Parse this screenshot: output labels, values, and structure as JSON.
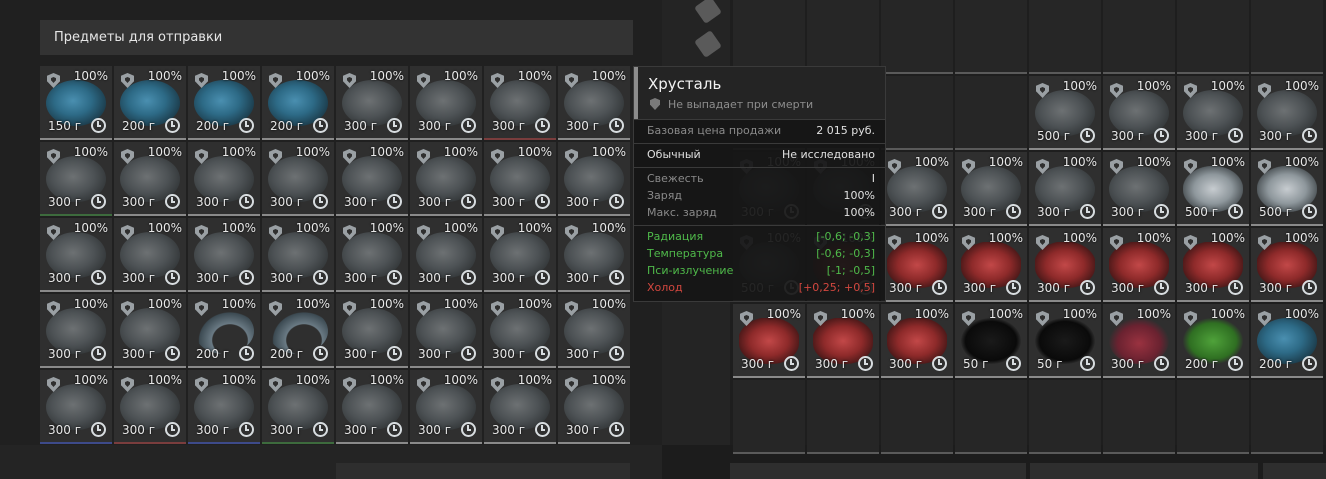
{
  "header": {
    "title": "Предметы для отправки"
  },
  "left_items": [
    {
      "pct": "100%",
      "weight": "150 г",
      "art": "blue",
      "border": "gray"
    },
    {
      "pct": "100%",
      "weight": "200 г",
      "art": "blue",
      "border": "gray"
    },
    {
      "pct": "100%",
      "weight": "200 г",
      "art": "blue",
      "border": "gray"
    },
    {
      "pct": "100%",
      "weight": "200 г",
      "art": "blue",
      "border": "gray"
    },
    {
      "pct": "100%",
      "weight": "300 г",
      "art": "stone",
      "border": "gray"
    },
    {
      "pct": "100%",
      "weight": "300 г",
      "art": "stone",
      "border": "gray"
    },
    {
      "pct": "100%",
      "weight": "300 г",
      "art": "stone",
      "border": "red"
    },
    {
      "pct": "100%",
      "weight": "300 г",
      "art": "stone",
      "border": "gray"
    },
    {
      "pct": "100%",
      "weight": "300 г",
      "art": "stone",
      "border": "green"
    },
    {
      "pct": "100%",
      "weight": "300 г",
      "art": "stone",
      "border": "gray"
    },
    {
      "pct": "100%",
      "weight": "300 г",
      "art": "stone",
      "border": "gray"
    },
    {
      "pct": "100%",
      "weight": "300 г",
      "art": "stone",
      "border": "gray"
    },
    {
      "pct": "100%",
      "weight": "300 г",
      "art": "stone",
      "border": "gray"
    },
    {
      "pct": "100%",
      "weight": "300 г",
      "art": "stone",
      "border": "gray"
    },
    {
      "pct": "100%",
      "weight": "300 г",
      "art": "stone",
      "border": "gray"
    },
    {
      "pct": "100%",
      "weight": "300 г",
      "art": "stone",
      "border": "gray"
    },
    {
      "pct": "100%",
      "weight": "300 г",
      "art": "stone",
      "border": "gray"
    },
    {
      "pct": "100%",
      "weight": "300 г",
      "art": "stone",
      "border": "gray"
    },
    {
      "pct": "100%",
      "weight": "300 г",
      "art": "stone",
      "border": "gray"
    },
    {
      "pct": "100%",
      "weight": "300 г",
      "art": "stone",
      "border": "gray"
    },
    {
      "pct": "100%",
      "weight": "300 г",
      "art": "stone",
      "border": "gray"
    },
    {
      "pct": "100%",
      "weight": "300 г",
      "art": "stone",
      "border": "gray"
    },
    {
      "pct": "100%",
      "weight": "300 г",
      "art": "stone",
      "border": "gray"
    },
    {
      "pct": "100%",
      "weight": "300 г",
      "art": "stone",
      "border": "gray"
    },
    {
      "pct": "100%",
      "weight": "300 г",
      "art": "stone",
      "border": "gray"
    },
    {
      "pct": "100%",
      "weight": "300 г",
      "art": "stone",
      "border": "gray"
    },
    {
      "pct": "100%",
      "weight": "200 г",
      "art": "crescent",
      "border": "gray"
    },
    {
      "pct": "100%",
      "weight": "200 г",
      "art": "crescent",
      "border": "gray"
    },
    {
      "pct": "100%",
      "weight": "300 г",
      "art": "stone",
      "border": "gray"
    },
    {
      "pct": "100%",
      "weight": "300 г",
      "art": "stone",
      "border": "gray"
    },
    {
      "pct": "100%",
      "weight": "300 г",
      "art": "stone",
      "border": "gray"
    },
    {
      "pct": "100%",
      "weight": "300 г",
      "art": "stone",
      "border": "gray"
    },
    {
      "pct": "100%",
      "weight": "300 г",
      "art": "stone",
      "border": "blue"
    },
    {
      "pct": "100%",
      "weight": "300 г",
      "art": "stone",
      "border": "red"
    },
    {
      "pct": "100%",
      "weight": "300 г",
      "art": "stone",
      "border": "blue"
    },
    {
      "pct": "100%",
      "weight": "300 г",
      "art": "stone",
      "border": "green"
    },
    {
      "pct": "100%",
      "weight": "300 г",
      "art": "stone",
      "border": "gray"
    },
    {
      "pct": "100%",
      "weight": "300 г",
      "art": "stone",
      "border": "gray"
    },
    {
      "pct": "100%",
      "weight": "300 г",
      "art": "stone",
      "border": "gray"
    },
    {
      "pct": "100%",
      "weight": "300 г",
      "art": "stone",
      "border": "gray"
    }
  ],
  "right_items": [
    null,
    null,
    null,
    null,
    null,
    null,
    null,
    null,
    null,
    null,
    null,
    null,
    {
      "pct": "100%",
      "weight": "500 г",
      "art": "stone",
      "border": "gray"
    },
    {
      "pct": "100%",
      "weight": "300 г",
      "art": "stone",
      "border": "gray"
    },
    {
      "pct": "100%",
      "weight": "300 г",
      "art": "stone",
      "border": "gray"
    },
    {
      "pct": "100%",
      "weight": "300 г",
      "art": "stone",
      "border": "gray"
    },
    {
      "pct": "100%",
      "weight": "300 г",
      "art": "stone",
      "border": "gray"
    },
    {
      "pct": "100%",
      "weight": "",
      "art": "stone",
      "border": "gray"
    },
    {
      "pct": "100%",
      "weight": "300 г",
      "art": "stone",
      "border": "gray"
    },
    {
      "pct": "100%",
      "weight": "300 г",
      "art": "stone",
      "border": "gray"
    },
    {
      "pct": "100%",
      "weight": "300 г",
      "art": "stone",
      "border": "gray"
    },
    {
      "pct": "100%",
      "weight": "300 г",
      "art": "stone",
      "border": "gray"
    },
    {
      "pct": "100%",
      "weight": "500 г",
      "art": "white",
      "border": "gray"
    },
    {
      "pct": "100%",
      "weight": "500 г",
      "art": "white",
      "border": "gray"
    },
    {
      "pct": "100%",
      "weight": "500 г",
      "art": "stone",
      "border": "gray"
    },
    {
      "pct": "100%",
      "weight": "",
      "art": "red",
      "border": "gray"
    },
    {
      "pct": "100%",
      "weight": "300 г",
      "art": "red",
      "border": "gray"
    },
    {
      "pct": "100%",
      "weight": "300 г",
      "art": "red",
      "border": "gray"
    },
    {
      "pct": "100%",
      "weight": "300 г",
      "art": "red",
      "border": "gray"
    },
    {
      "pct": "100%",
      "weight": "300 г",
      "art": "red",
      "border": "gray"
    },
    {
      "pct": "100%",
      "weight": "300 г",
      "art": "red",
      "border": "gray"
    },
    {
      "pct": "100%",
      "weight": "300 г",
      "art": "red",
      "border": "gray"
    },
    {
      "pct": "100%",
      "weight": "300 г",
      "art": "red",
      "border": "gray"
    },
    {
      "pct": "100%",
      "weight": "300 г",
      "art": "red",
      "border": "gray"
    },
    {
      "pct": "100%",
      "weight": "300 г",
      "art": "red",
      "border": "gray"
    },
    {
      "pct": "100%",
      "weight": "50 г",
      "art": "black",
      "border": "gray"
    },
    {
      "pct": "100%",
      "weight": "50 г",
      "art": "black",
      "border": "gray"
    },
    {
      "pct": "100%",
      "weight": "300 г",
      "art": "redcrystal",
      "border": "gray"
    },
    {
      "pct": "100%",
      "weight": "200 г",
      "art": "green",
      "border": "gray"
    },
    {
      "pct": "100%",
      "weight": "200 г",
      "art": "blue",
      "border": "gray"
    },
    null,
    null,
    null,
    null,
    null,
    null,
    null,
    null
  ],
  "tooltip": {
    "title": "Хрусталь",
    "subtitle": "Не выпадает при смерти",
    "base_price_label": "Базовая цена продажи",
    "base_price_value": "2 015 руб.",
    "rarity": "Обычный",
    "research": "Не исследовано",
    "freshness_label": "Свежесть",
    "freshness_value": "I",
    "charge_label": "Заряд",
    "charge_value": "100%",
    "max_charge_label": "Макс. заряд",
    "max_charge_value": "100%",
    "radiation_label": "Радиация",
    "radiation_value": "[-0,6; -0,3]",
    "temperature_label": "Температура",
    "temperature_value": "[-0,6; -0,3]",
    "psi_label": "Пси-излучение",
    "psi_value": "[-1; -0,5]",
    "cold_label": "Холод",
    "cold_value": "[+0,25; +0,5]"
  }
}
